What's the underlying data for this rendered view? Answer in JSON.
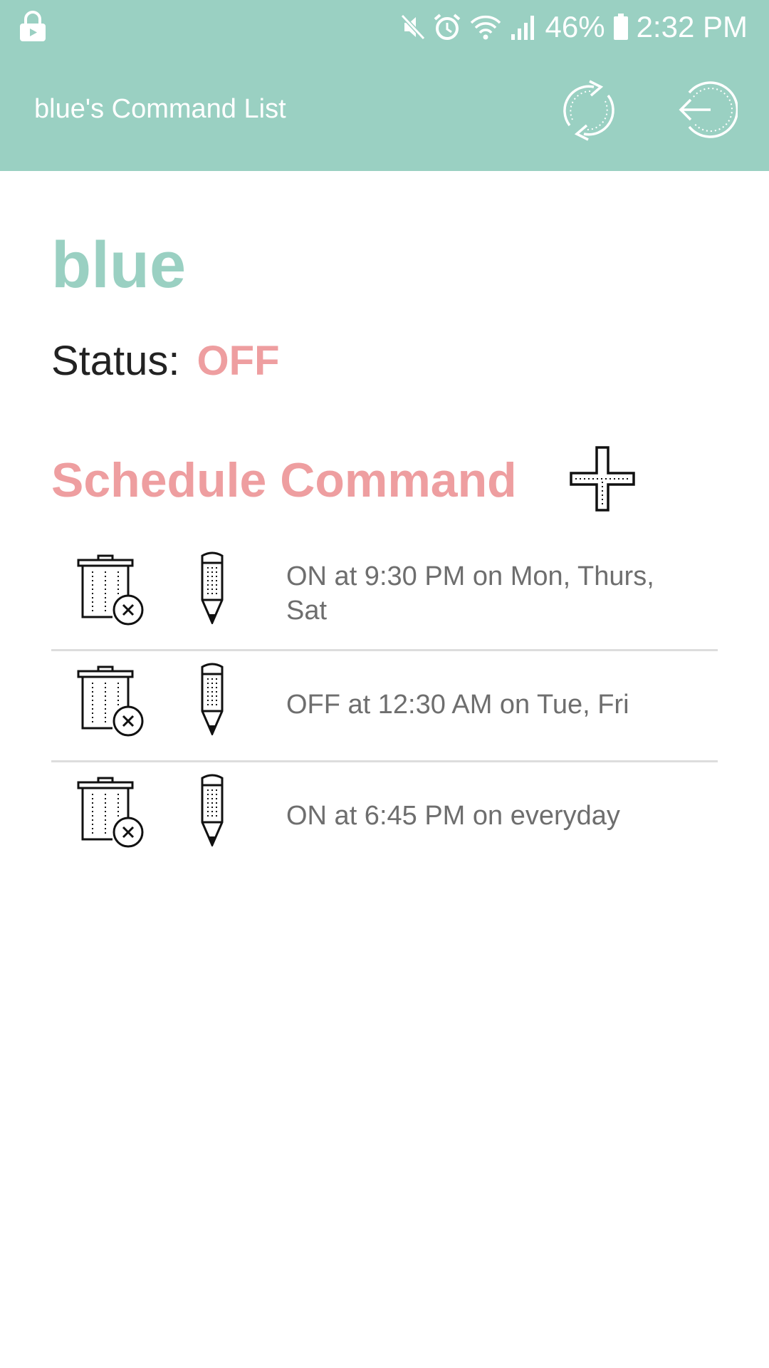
{
  "status_bar": {
    "battery": "46%",
    "time": "2:32 PM"
  },
  "app_bar": {
    "title": "blue's Command List",
    "refresh_icon": "refresh-icon",
    "logout_icon": "logout-icon"
  },
  "device": {
    "name": "blue",
    "status_label": "Status:",
    "status_value": "OFF"
  },
  "schedule": {
    "header": "Schedule Command",
    "add_icon": "plus-icon",
    "items": [
      {
        "text": "ON at 9:30 PM on Mon, Thurs, Sat"
      },
      {
        "text": "OFF at 12:30 AM on Tue, Fri"
      },
      {
        "text": "ON at 6:45 PM on everyday"
      }
    ]
  },
  "colors": {
    "primary": "#9AD0C2",
    "accent": "#EE9EA0",
    "text_dark": "#222222",
    "text_muted": "#6E6E6E",
    "divider": "#DDDDDD"
  }
}
